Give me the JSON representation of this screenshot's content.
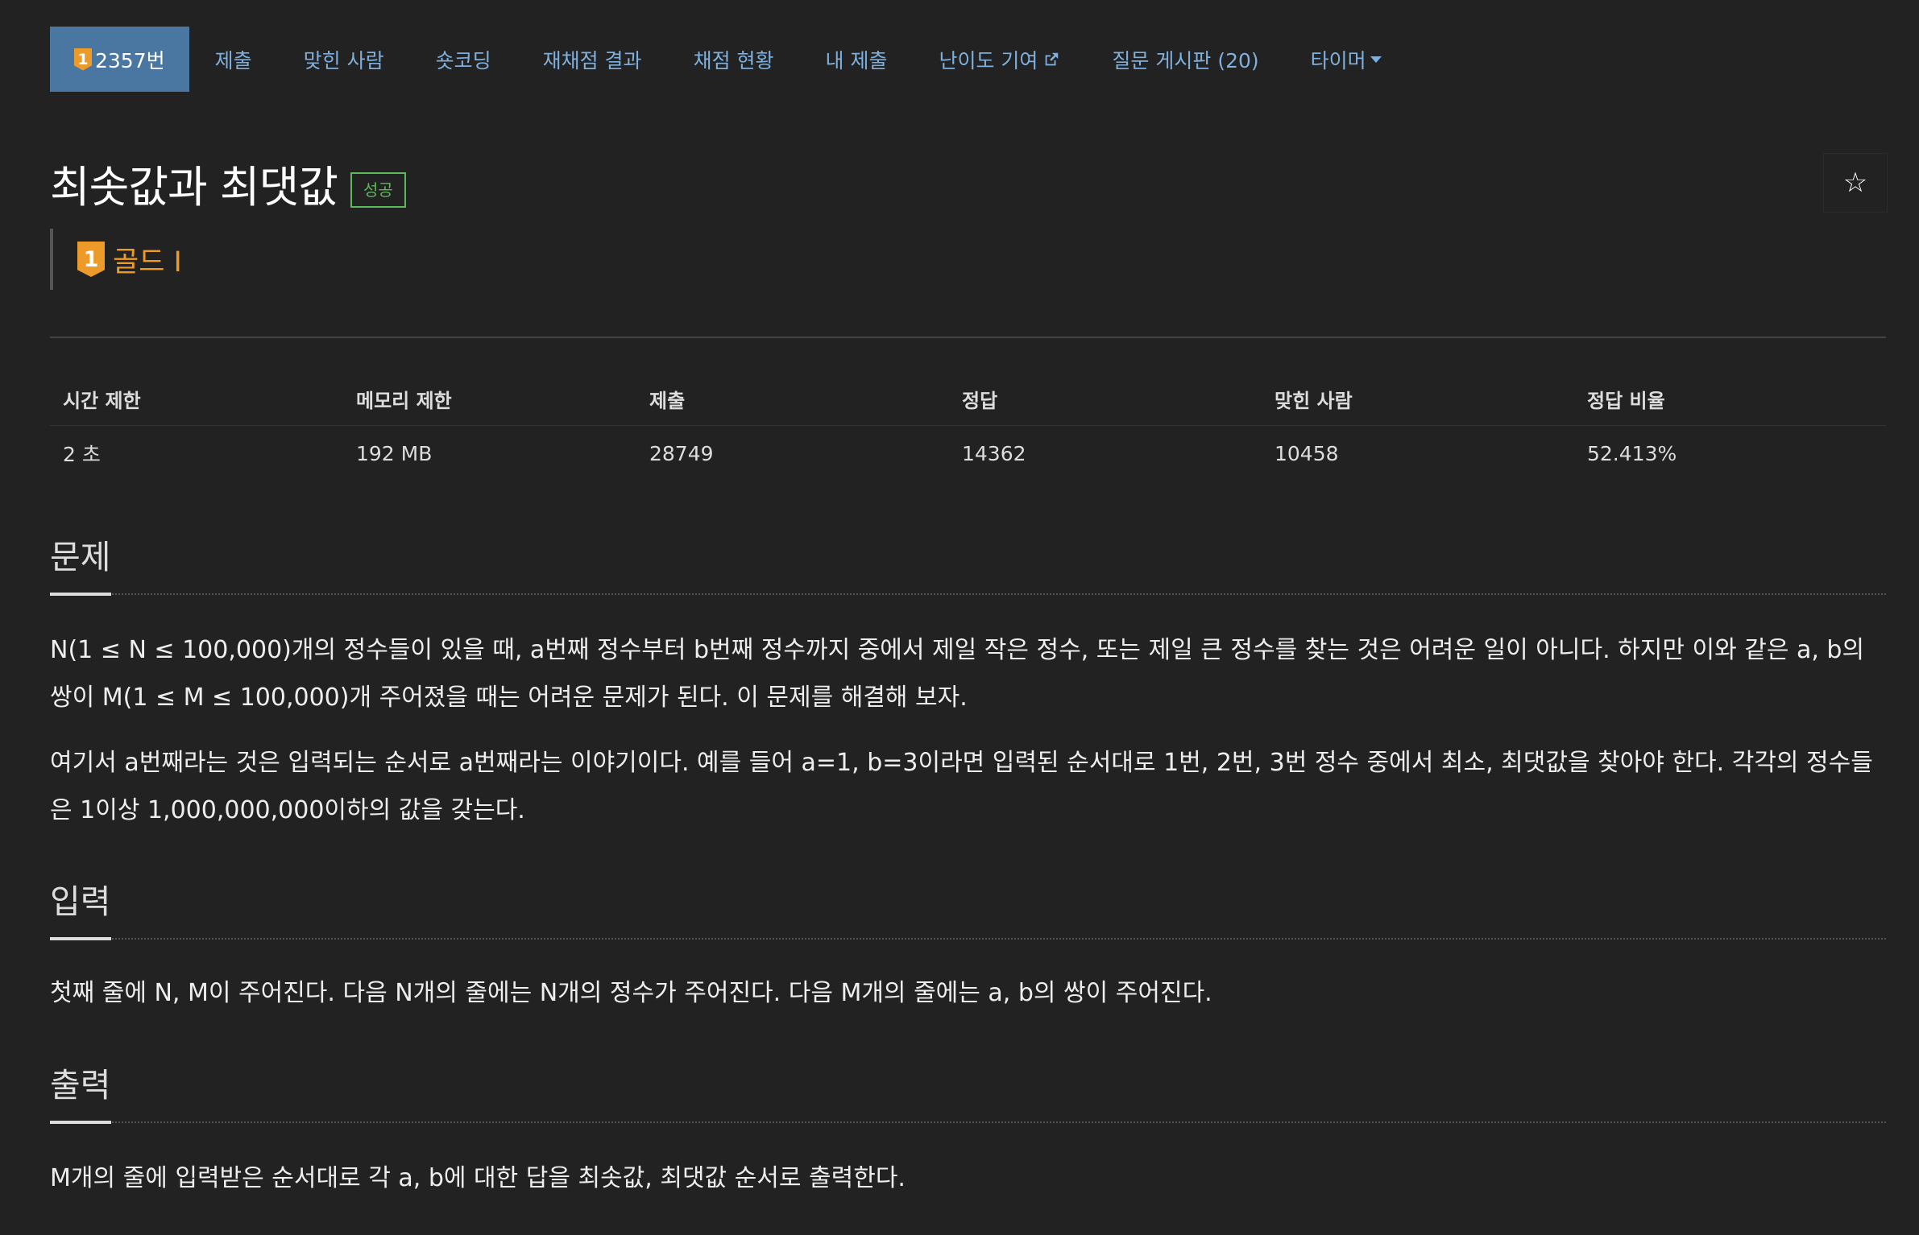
{
  "nav": {
    "items": [
      {
        "label": "2357번",
        "badge": "1"
      },
      {
        "label": "제출"
      },
      {
        "label": "맞힌 사람"
      },
      {
        "label": "숏코딩"
      },
      {
        "label": "재채점 결과"
      },
      {
        "label": "채점 현황"
      },
      {
        "label": "내 제출"
      },
      {
        "label": "난이도 기여"
      },
      {
        "label": "질문 게시판 (20)"
      },
      {
        "label": "타이머"
      }
    ]
  },
  "problem": {
    "title": "최솟값과 최댓값",
    "result_badge": "성공",
    "star": "☆",
    "tier": {
      "badge": "1",
      "label": "골드 I"
    }
  },
  "info": {
    "headers": [
      "시간 제한",
      "메모리 제한",
      "제출",
      "정답",
      "맞힌 사람",
      "정답 비율"
    ],
    "values": [
      "2 초",
      "192 MB",
      "28749",
      "14362",
      "10458",
      "52.413%"
    ]
  },
  "sections": {
    "problem": {
      "title": "문제",
      "paragraphs": [
        "N(1 ≤ N ≤ 100,000)개의 정수들이 있을 때, a번째 정수부터 b번째 정수까지 중에서 제일 작은 정수, 또는 제일 큰 정수를 찾는 것은 어려운 일이 아니다. 하지만 이와 같은 a, b의 쌍이 M(1 ≤ M ≤ 100,000)개 주어졌을 때는 어려운 문제가 된다. 이 문제를 해결해 보자.",
        "여기서 a번째라는 것은 입력되는 순서로 a번째라는 이야기이다. 예를 들어 a=1, b=3이라면 입력된 순서대로 1번, 2번, 3번 정수 중에서 최소, 최댓값을 찾아야 한다. 각각의 정수들은 1이상 1,000,000,000이하의 값을 갖는다."
      ]
    },
    "input": {
      "title": "입력",
      "paragraphs": [
        "첫째 줄에 N, M이 주어진다. 다음 N개의 줄에는 N개의 정수가 주어진다. 다음 M개의 줄에는 a, b의 쌍이 주어진다."
      ]
    },
    "output": {
      "title": "출력",
      "paragraphs": [
        "M개의 줄에 입력받은 순서대로 각 a, b에 대한 답을 최솟값, 최댓값 순서로 출력한다."
      ]
    }
  },
  "colors": {
    "background": "#222222",
    "nav_active_bg": "#4a77a2",
    "link": "#7fb0dd",
    "gold": "#ec9a29",
    "success": "#5cb85c"
  },
  "icons": {
    "external_link": "external-link-icon",
    "caret": "caret-down-icon",
    "star": "star-outline-icon"
  }
}
